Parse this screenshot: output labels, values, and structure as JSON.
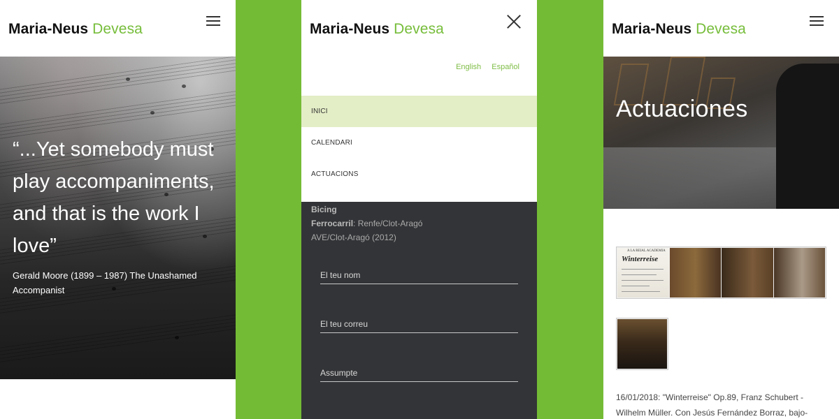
{
  "brand": {
    "first": "Maria-Neus",
    "last": "Devesa"
  },
  "panel1": {
    "quote": "“...Yet somebody must play accompaniments, and that is the work I love”",
    "author": "Gerald Moore (1899 – 1987) The Unashamed Accompanist"
  },
  "panel2": {
    "languages": [
      "English",
      "Español"
    ],
    "menu": [
      {
        "label": "INICI",
        "active": true
      },
      {
        "label": "CALENDARI",
        "active": false
      },
      {
        "label": "ACTUACIONS",
        "active": false
      }
    ],
    "transport": {
      "bicing_label": "Bicing",
      "rail_label": "Ferrocarril",
      "rail_value": ": Renfe/Clot-Aragó",
      "ave_value": "AVE/Clot-Aragó (2012)"
    },
    "form": {
      "name_placeholder": "El teu nom",
      "email_placeholder": "El teu correu",
      "subject_placeholder": "Assumpte"
    }
  },
  "panel3": {
    "page_title": "Actuaciones",
    "poster": {
      "academy": "A LA REIAL ACADEMIA",
      "title": "Winterreise"
    },
    "description": "16/01/2018: \"Winterreise\" Op.89, Franz Schubert -Wilhelm Müller. Con Jesús Fernández Borraz, bajo-"
  },
  "colors": {
    "accent": "#74bb35",
    "menu_active": "#e3edc6",
    "dark_bg": "#333437"
  }
}
